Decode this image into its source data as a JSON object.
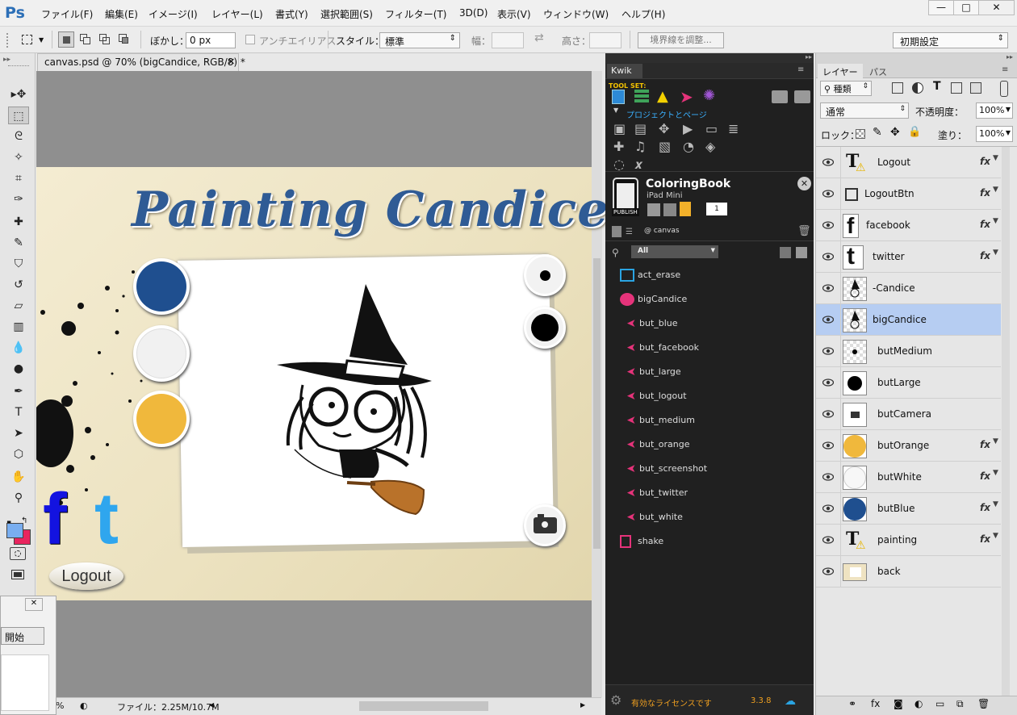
{
  "app": {
    "logo": "Ps"
  },
  "menu": [
    "ファイル(F)",
    "編集(E)",
    "イメージ(I)",
    "レイヤー(L)",
    "書式(Y)",
    "選択範囲(S)",
    "フィルター(T)",
    "3D(D)",
    "表示(V)",
    "ウィンドウ(W)",
    "ヘルプ(H)"
  ],
  "window": {
    "minimize": "—",
    "maximize": "□",
    "close": "✕"
  },
  "options": {
    "feather_label": "ぼかし：",
    "feather_value": "0 px",
    "antialias_label": "アンチエイリアス",
    "style_label": "スタイル：",
    "style_value": "標準",
    "width_label": "幅：",
    "height_label": "高さ：",
    "refine_button": "境界線を調整...",
    "workspace": "初期設定"
  },
  "document": {
    "tab": "canvas.psd @ 70% (bigCandice, RGB/8) *",
    "title_text": "Painting Candice",
    "logout_text": "Logout",
    "colors": {
      "blue": "#1f4f8f",
      "white": "#f1f1f1",
      "orange": "#f0b83c"
    }
  },
  "status": {
    "zoom": "%",
    "file": "ファイル：2.25M/10.7M"
  },
  "kwik": {
    "tab": "Kwik",
    "toolset": "TOOL SET:",
    "toolset_caption": "プロジェクトとページ",
    "project_name": "ColoringBook",
    "project_device": "iPad Mini",
    "publish": "PUBLISH",
    "page_number": "1",
    "page_label": "@ canvas",
    "filter": "All",
    "items": [
      {
        "name": "act_erase",
        "icon": "action-icon"
      },
      {
        "name": "bigCandice",
        "icon": "palette-icon"
      },
      {
        "name": "but_blue",
        "icon": "cursor-icon"
      },
      {
        "name": "but_facebook",
        "icon": "cursor-icon"
      },
      {
        "name": "but_large",
        "icon": "cursor-icon"
      },
      {
        "name": "but_logout",
        "icon": "cursor-icon"
      },
      {
        "name": "but_medium",
        "icon": "cursor-icon"
      },
      {
        "name": "but_orange",
        "icon": "cursor-icon"
      },
      {
        "name": "but_screenshot",
        "icon": "cursor-icon"
      },
      {
        "name": "but_twitter",
        "icon": "cursor-icon"
      },
      {
        "name": "but_white",
        "icon": "cursor-icon"
      },
      {
        "name": "shake",
        "icon": "shake-icon"
      }
    ],
    "license": "有効なライセンスです",
    "version": "3.3.8"
  },
  "layers_panel": {
    "tab_layers": "レイヤー",
    "tab_paths": "パス",
    "kind": "種類",
    "blend": "通常",
    "opacity_label": "不透明度：",
    "opacity": "100%",
    "lock_label": "ロック：",
    "fill_label": "塗り：",
    "fill": "100%",
    "layers": [
      {
        "name": "Logout",
        "fx": true,
        "thumb": "text"
      },
      {
        "name": "LogoutBtn",
        "fx": true,
        "thumb": "frame"
      },
      {
        "name": "facebook",
        "fx": true,
        "thumb": "f"
      },
      {
        "name": "twitter",
        "fx": true,
        "thumb": "t"
      },
      {
        "name": "-Candice",
        "fx": false,
        "thumb": "witch"
      },
      {
        "name": "bigCandice",
        "fx": false,
        "thumb": "witch",
        "selected": true
      },
      {
        "name": "butMedium",
        "fx": false,
        "thumb": "dot-small"
      },
      {
        "name": "butLarge",
        "fx": false,
        "thumb": "dot-large"
      },
      {
        "name": "butCamera",
        "fx": false,
        "thumb": "camera"
      },
      {
        "name": "butOrange",
        "fx": true,
        "thumb": "orange"
      },
      {
        "name": "butWhite",
        "fx": true,
        "thumb": "white"
      },
      {
        "name": "butBlue",
        "fx": true,
        "thumb": "blue"
      },
      {
        "name": "painting",
        "fx": true,
        "thumb": "text"
      },
      {
        "name": "back",
        "fx": false,
        "thumb": "back"
      }
    ]
  },
  "dialog": {
    "start_button": "開始"
  }
}
